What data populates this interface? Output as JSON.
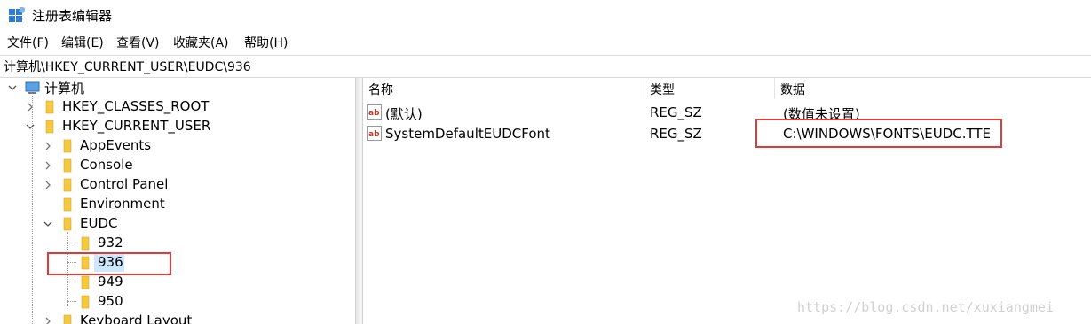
{
  "window": {
    "title": "注册表编辑器"
  },
  "menu": [
    "文件(F)",
    "编辑(E)",
    "查看(V)",
    "收藏夹(A)",
    "帮助(H)"
  ],
  "address": "计算机\\HKEY_CURRENT_USER\\EUDC\\936",
  "tree": {
    "root": "计算机",
    "hkcr": "HKEY_CLASSES_ROOT",
    "hkcu": "HKEY_CURRENT_USER",
    "appevents": "AppEvents",
    "console": "Console",
    "control_panel": "Control Panel",
    "environment": "Environment",
    "eudc": "EUDC",
    "k932": "932",
    "k936": "936",
    "k949": "949",
    "k950": "950",
    "keyboard_layout": "Keyboard Layout"
  },
  "columns": {
    "name": "名称",
    "type": "类型",
    "data": "数据"
  },
  "values": [
    {
      "name": "(默认)",
      "type": "REG_SZ",
      "data": "(数值未设置)"
    },
    {
      "name": "SystemDefaultEUDCFont",
      "type": "REG_SZ",
      "data": "C:\\WINDOWS\\FONTS\\EUDC.TTE"
    }
  ],
  "watermark": "https://blog.csdn.net/xuxiangmei",
  "colors": {
    "highlight": "#e53935",
    "selection": "#cce8ff",
    "folder": "#f5c842"
  }
}
